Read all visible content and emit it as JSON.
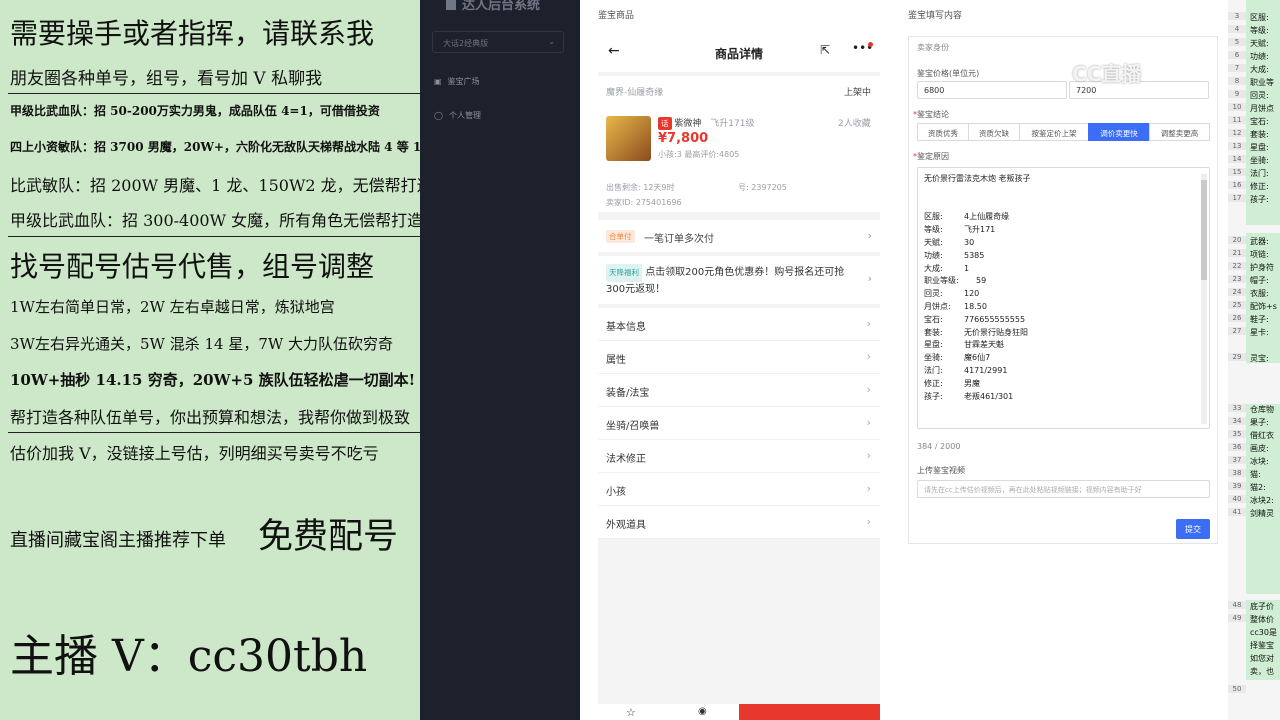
{
  "stream": {
    "lines": [
      "需要操手或者指挥，请联系我",
      "朋友圈各种单号，组号，看号加 V 私聊我",
      "甲级比武血队：招 50-200万实力男鬼，成品队伍 4=1，可借借投资",
      "四上小资敏队：招 3700 男魔，20W+，六阶化无敌队天梯帮战水陆 4 等 1",
      "比武敏队：招 200W 男魔、1 龙、150W2 龙，无偿帮打造",
      "甲级比武血队：招 300-400W 女魔，所有角色无偿帮打造",
      "找号配号估号代售，组号调整",
      "1W左右简单日常，2W 左右卓越日常，炼狱地宫",
      "3W左右异光通关，5W 混杀 14 星，7W 大力队伍砍穷奇",
      "10W+抽秒 14.15 穷奇，20W+5 族队伍轻松虐一切副本!",
      "帮打造各种队伍单号，你出预算和想法，我帮你做到极致",
      "估价加我 V，没链接上号估，列明细买号卖号不吃亏",
      "直播间藏宝阁主播推荐下单",
      "免费配号",
      "主播 V：cc30tbh"
    ]
  },
  "admin": {
    "title": "达人后台系统",
    "server_select": "大话2经典版",
    "nav": [
      {
        "icon": "chart-icon",
        "label": "鉴宝广场"
      },
      {
        "icon": "user-icon",
        "label": "个人管理"
      }
    ]
  },
  "sections": {
    "left_title": "鉴宝商品",
    "right_title": "鉴宝填写内容"
  },
  "product": {
    "page_title": "商品详情",
    "server": "魔界-仙履奇缘",
    "status": "上架中",
    "role_name": "紫微神",
    "role_level": "飞升171级",
    "favorites": "2人收藏",
    "price": "¥7,800",
    "sub_info": "小孩:3  最高评价:4805",
    "remaining": "出售剩余: 12天9时",
    "number": "号: 2397205",
    "seller_id": "卖家ID: 275401696",
    "multi_pay_badge": "合单付",
    "multi_pay_text": "一笔订单多次付",
    "promo_badge": "天降福利",
    "promo_text": "点击领取200元角色优惠券！购号报名还可抢300元返现！",
    "menu": [
      "基本信息",
      "属性",
      "装备/法宝",
      "坐骑/召唤兽",
      "法术修正",
      "小孩",
      "外观道具"
    ]
  },
  "form": {
    "section_seller": "卖家身份",
    "price_label": "鉴宝价格(单位元)",
    "price_value": "6800",
    "price_value2": "7200",
    "conclusion_label": "鉴宝结论",
    "conclusions": [
      "资质优秀",
      "资质欠缺",
      "按鉴定价上架",
      "调价卖更快",
      "调整卖更高"
    ],
    "active_conclusion": 3,
    "reason_label": "鉴定原因",
    "reason_intro": "无价景行雷法克木炮 老叛孩子",
    "reason_rows": [
      {
        "k": "区服:",
        "v": "4上仙履奇缘"
      },
      {
        "k": "等级:",
        "v": "飞升171"
      },
      {
        "k": "天赋:",
        "v": "30"
      },
      {
        "k": "功绩:",
        "v": "5385"
      },
      {
        "k": "大成:",
        "v": "1"
      },
      {
        "k": "职业等级:",
        "v": "59"
      },
      {
        "k": "回灵:",
        "v": "120"
      },
      {
        "k": "月饼点:",
        "v": "18.50"
      },
      {
        "k": "宝石:",
        "v": "776655555555"
      },
      {
        "k": "套装:",
        "v": "无价景行贴身狂阳"
      },
      {
        "k": "星盘:",
        "v": "甘霖差天魁"
      },
      {
        "k": "坐骑:",
        "v": "魔6仙7"
      },
      {
        "k": "法门:",
        "v": "4171/2991"
      },
      {
        "k": "修正:",
        "v": "男魔"
      },
      {
        "k": "孩子:",
        "v": "老叛461/301"
      }
    ],
    "char_count": "384 / 2000",
    "video_label": "上传鉴宝视频",
    "video_placeholder": "请先在cc上传估价视频后，再在此处粘贴视频链接；视频内容有助于好",
    "submit": "提交"
  },
  "sheet": {
    "rows": [
      {
        "n": "3",
        "t": "区服:"
      },
      {
        "n": "4",
        "t": "等级:"
      },
      {
        "n": "5",
        "t": "天赋:"
      },
      {
        "n": "6",
        "t": "功绩:"
      },
      {
        "n": "7",
        "t": "大成:"
      },
      {
        "n": "8",
        "t": "职业等"
      },
      {
        "n": "9",
        "t": "回灵:"
      },
      {
        "n": "10",
        "t": "月饼点"
      },
      {
        "n": "11",
        "t": "宝石:"
      },
      {
        "n": "12",
        "t": "套装:"
      },
      {
        "n": "13",
        "t": "星盘:"
      },
      {
        "n": "14",
        "t": "坐骑:"
      },
      {
        "n": "15",
        "t": "法门:"
      },
      {
        "n": "16",
        "t": "修正:"
      },
      {
        "n": "17",
        "t": "孩子:"
      },
      {
        "n": "20",
        "t": "武器:"
      },
      {
        "n": "21",
        "t": "项链:"
      },
      {
        "n": "22",
        "t": "护身符"
      },
      {
        "n": "23",
        "t": "帽子:"
      },
      {
        "n": "24",
        "t": "衣服:"
      },
      {
        "n": "25",
        "t": "配饰+s"
      },
      {
        "n": "26",
        "t": "鞋子:"
      },
      {
        "n": "27",
        "t": "星卡:"
      },
      {
        "n": "29",
        "t": "灵宝:"
      },
      {
        "n": "33",
        "t": "仓库物"
      },
      {
        "n": "34",
        "t": "果子:"
      },
      {
        "n": "35",
        "t": "借红衣"
      },
      {
        "n": "36",
        "t": "画皮:"
      },
      {
        "n": "37",
        "t": "冰块:"
      },
      {
        "n": "38",
        "t": "猫:"
      },
      {
        "n": "39",
        "t": "猫2:"
      },
      {
        "n": "40",
        "t": "冰块2:"
      },
      {
        "n": "41",
        "t": "剑精灵"
      },
      {
        "n": "48",
        "t": "底子价"
      },
      {
        "n": "49",
        "t": "整体价"
      },
      {
        "n": "",
        "t": "cc30是"
      },
      {
        "n": "",
        "t": "择鉴宝"
      },
      {
        "n": "",
        "t": "如您对"
      },
      {
        "n": "",
        "t": "卖，也"
      },
      {
        "n": "50",
        "t": ""
      }
    ]
  },
  "watermark": "CC直播"
}
